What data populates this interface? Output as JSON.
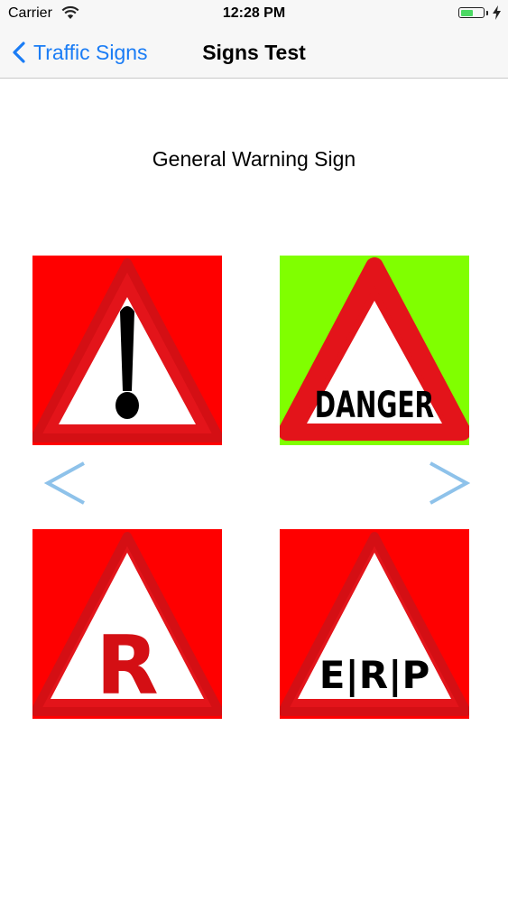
{
  "status_bar": {
    "carrier": "Carrier",
    "time": "12:28 PM",
    "battery_level": 0.6
  },
  "nav": {
    "back_label": "Traffic Signs",
    "title": "Signs Test"
  },
  "question": "General Warning Sign",
  "options": [
    {
      "id": "exclamation",
      "label": "!",
      "background": "#ff0000",
      "icon": "exclamation-warning-sign"
    },
    {
      "id": "danger",
      "label": "DANGER",
      "background": "#80ff00",
      "icon": "danger-warning-sign"
    },
    {
      "id": "r",
      "label": "R",
      "background": "#ff0000",
      "icon": "r-warning-sign"
    },
    {
      "id": "erp",
      "label": "E|R|P",
      "background": "#ff0000",
      "icon": "erp-warning-sign"
    }
  ],
  "colors": {
    "accent": "#1a7cf5",
    "sign_red": "#e3141a",
    "arrow": "#8ec2ea",
    "selected_background": "#80ff00"
  }
}
